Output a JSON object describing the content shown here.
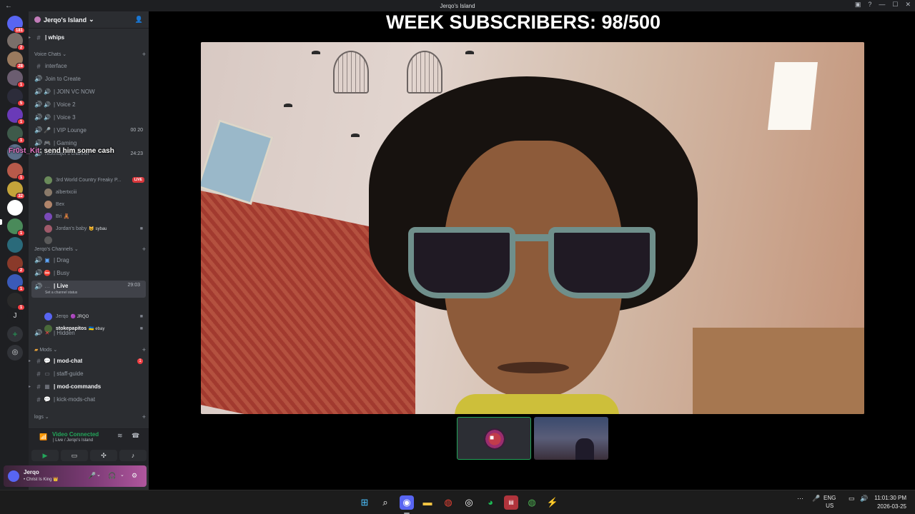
{
  "window": {
    "title": "Jerqo's Island",
    "back_glyph": "←"
  },
  "rail": {
    "home_badge": "181",
    "servers": [
      {
        "badge": "2",
        "color": "#7a6f6a"
      },
      {
        "badge": "28",
        "color": "#9a7a5e"
      },
      {
        "badge": "1",
        "color": "#6b5d70"
      },
      {
        "badge": "5",
        "color": "#2c2c3a"
      },
      {
        "badge": "1",
        "color": "#6a3ab8"
      },
      {
        "badge": "1",
        "color": "#3e5a4a"
      },
      {
        "badge": "",
        "color": "#5b6f8a"
      },
      {
        "badge": "1",
        "color": "#b85a4a"
      },
      {
        "badge": "32",
        "color": "#c4a43a"
      },
      {
        "badge": "",
        "color": "#ffffff"
      },
      {
        "badge": "1",
        "color": "#4a8a5a"
      },
      {
        "badge": "",
        "color": "#2a6a7a"
      },
      {
        "badge": "2",
        "color": "#8a3a2a"
      },
      {
        "badge": "1",
        "color": "#3a5ab8"
      },
      {
        "badge": "1",
        "color": "#2a2a2a"
      }
    ],
    "letter_server": "J"
  },
  "guild": {
    "name": "Jerqo's Island",
    "chevron": "⌄"
  },
  "channels": {
    "whips": "| whips",
    "cat_voice": "Voice Chats",
    "interface": "interface",
    "join_create": "Join to Create",
    "join_vc": "| JOIN VC NOW",
    "voice2": "| Voice 2",
    "voice3": "| Voice 3",
    "vip": "| VIP Lounge",
    "vip_count_a": "00",
    "vip_count_b": "20",
    "gaming": "| Gaming",
    "nickmajor": "nickmajor's channel",
    "nickmajor_time": "24:23",
    "cat_jerqo": "Jerqo's Channels",
    "drag": "| Drag",
    "busy": "| Busy",
    "live": "| Live",
    "live_time": "29:03",
    "live_status": "Set a channel status",
    "hidden": "| Hidden",
    "cat_mods": "Mods",
    "mod_chat": "| mod-chat",
    "mod_chat_unread": "1",
    "staff_guide": "| staff-guide",
    "mod_commands": "| mod-commands",
    "kick_mods": "| kick-mods-chat",
    "cat_logs": "logs"
  },
  "members_nick": [
    {
      "name": "3rd World Country Freaky P...",
      "badge": "LIVE",
      "color": "#6a8a5a"
    },
    {
      "name": "albertxciii",
      "badge": "",
      "color": "#8a7a6a"
    },
    {
      "name": "Bex",
      "badge": "",
      "color": "#b0846a"
    },
    {
      "name": "Bri 🧸",
      "badge": "",
      "color": "#7a4ab8"
    },
    {
      "name": "Jordan's baby",
      "tag": "😺 sybau",
      "color": "#a05a6a"
    },
    {
      "name": "",
      "badge": "",
      "color": "#5a5a5a"
    }
  ],
  "members_live": [
    {
      "name": "Jerqo",
      "tag": "🟣 JRQO",
      "color": "#5865f2"
    },
    {
      "name": "stokepapitos",
      "tag": "🇺🇦 ebay",
      "color": "#4a6a3a"
    }
  ],
  "overlay_chat": {
    "name": "Fr0st_Kit",
    "message": ": send him some cash"
  },
  "voice_panel": {
    "state": "Video Connected",
    "location": "| Live / Jerqo's Island"
  },
  "user": {
    "name": "Jerqo",
    "status": "• Christ Is King 👑"
  },
  "stream": {
    "headline": "WEEK SUBSCRIBERS: 98/500"
  },
  "taskbar": {
    "lang_1": "ENG",
    "lang_2": "US",
    "time": "11:01:30 PM",
    "date": "2026-03-25"
  },
  "colors": {
    "accent": "#5865f2",
    "connected": "#23a55a",
    "danger": "#f23f43"
  }
}
